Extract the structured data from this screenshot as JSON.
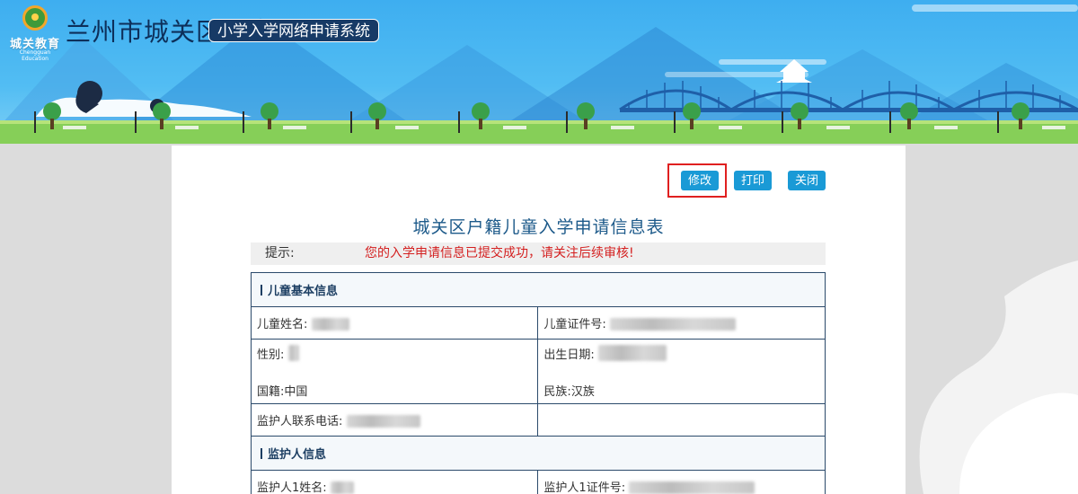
{
  "header": {
    "logo_text": "城关教育",
    "logo_subtext": "Chengguan Education",
    "site_title": "兰州市城关区",
    "system_name": "小学入学网络申请系统"
  },
  "toolbar": {
    "edit_label": "修改",
    "print_label": "打印",
    "close_label": "关闭"
  },
  "form": {
    "title": "城关区户籍儿童入学申请信息表",
    "tip_label": "提示:",
    "tip_message": "您的入学申请信息已提交成功，请关注后续审核!",
    "sections": {
      "child": "儿童基本信息",
      "guardian": "监护人信息"
    },
    "labels": {
      "child_name": "儿童姓名:",
      "child_id": "儿童证件号:",
      "gender": "性别:",
      "birth_date": "出生日期:",
      "nationality": "国籍:",
      "ethnicity": "民族:",
      "guardian_phone": "监护人联系电话:",
      "guardian1_name": "监护人1姓名:",
      "guardian1_id": "监护人1证件号:"
    },
    "values": {
      "nationality": "中国",
      "ethnicity": "汉族"
    }
  },
  "colors": {
    "banner_blue": "#3eaef0",
    "button_blue": "#1a9ad6",
    "title_blue": "#1d5a8a",
    "alert_red": "#d42020",
    "table_border": "#2b4a6b"
  }
}
